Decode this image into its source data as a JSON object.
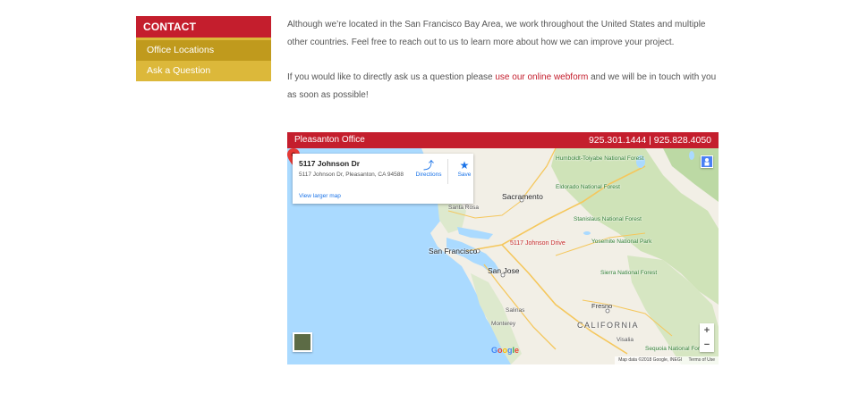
{
  "sidebar": {
    "heading": "CONTACT",
    "items": [
      {
        "label": "Office Locations",
        "active": true
      },
      {
        "label": "Ask a Question",
        "active": false
      }
    ]
  },
  "content": {
    "paragraph1": "Although we’re located in the San Francisco Bay Area, we work throughout the United States and multiple other countries. Feel free to reach out to us to learn more about how we can improve your project.",
    "paragraph2_before": "If you would like to directly ask us a question please ",
    "paragraph2_link": "use our online webform",
    "paragraph2_after": " and we will be in touch with you as soon as possible!"
  },
  "office": {
    "name": "Pleasanton Office",
    "phones": "925.301.1444 | 925.828.4050"
  },
  "map": {
    "card": {
      "title": "5117 Johnson Dr",
      "address": "5117 Johnson Dr, Pleasanton, CA 94588",
      "directions_label": "Directions",
      "save_label": "Save",
      "larger_map_label": "View larger map"
    },
    "labels": {
      "sacramento": "Sacramento",
      "santa_rosa": "Santa Rosa",
      "san_francisco": "San Francisco",
      "san_jose": "San Jose",
      "fresno": "Fresno",
      "california": "CALIFORNIA",
      "pin": "5117 Johnson Drive",
      "humboldt": "Humboldt-Toiyabe National Forest",
      "eldorado": "Eldorado National Forest",
      "stanislaus": "Stanislaus National Forest",
      "yosemite": "Yosemite National Park",
      "sierra": "Sierra National Forest",
      "sequoia": "Sequoia National Forest",
      "salinas": "Salinas",
      "monterey": "Monterey",
      "visalia": "Visalia"
    },
    "zoom_in": "+",
    "zoom_out": "−",
    "google": "Google",
    "attribution_data": "Map data ©2018 Google, INEGI",
    "attribution_terms": "Terms of Use"
  },
  "colors": {
    "brand_red": "#c41e2d",
    "gold_active": "#c09a1d",
    "gold": "#dcb83a"
  }
}
